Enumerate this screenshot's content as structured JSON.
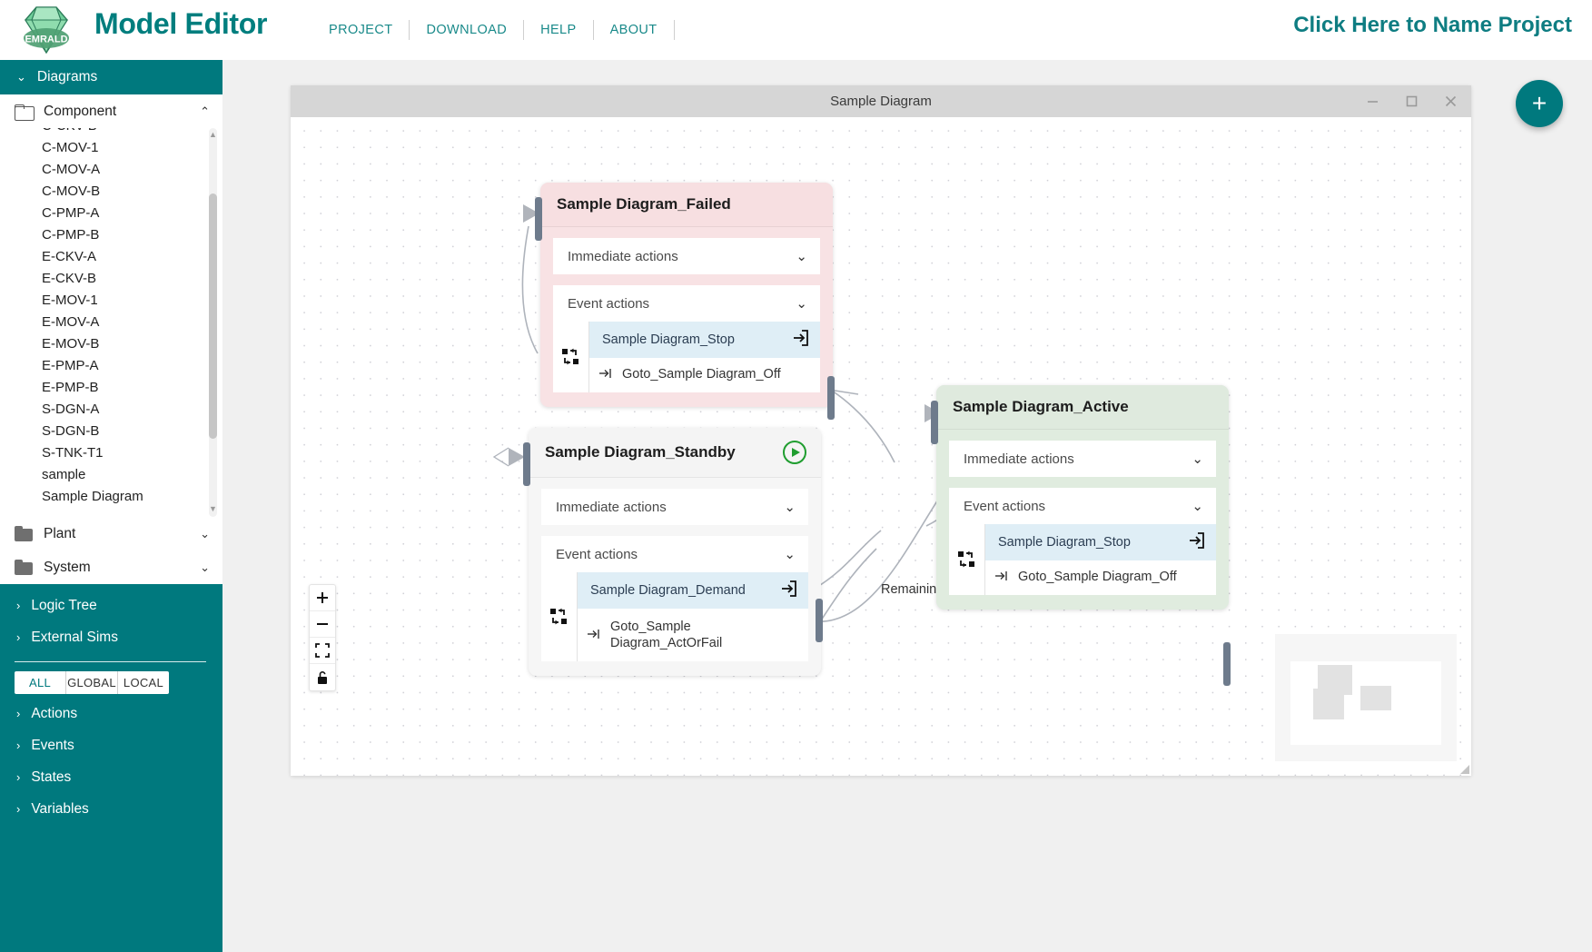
{
  "header": {
    "logo_text": "EMRALD",
    "app_title": "Model Editor",
    "nav": [
      {
        "label": "PROJECT"
      },
      {
        "label": "DOWNLOAD"
      },
      {
        "label": "HELP"
      },
      {
        "label": "ABOUT"
      }
    ],
    "project_name": "Click Here to Name Project",
    "accent_color": "#00797e"
  },
  "sidebar": {
    "section_title": "Diagrams",
    "folders": [
      {
        "label": "Component",
        "expanded": true,
        "caret": "⌃"
      },
      {
        "label": "Plant",
        "expanded": false,
        "caret": "⌄"
      },
      {
        "label": "System",
        "expanded": false,
        "caret": "⌄"
      }
    ],
    "component_items": [
      {
        "label": "C-CKV-B"
      },
      {
        "label": "C-MOV-1"
      },
      {
        "label": "C-MOV-A"
      },
      {
        "label": "C-MOV-B"
      },
      {
        "label": "C-PMP-A"
      },
      {
        "label": "C-PMP-B"
      },
      {
        "label": "E-CKV-A"
      },
      {
        "label": "E-CKV-B"
      },
      {
        "label": "E-MOV-1"
      },
      {
        "label": "E-MOV-A"
      },
      {
        "label": "E-MOV-B"
      },
      {
        "label": "E-PMP-A"
      },
      {
        "label": "E-PMP-B"
      },
      {
        "label": "S-DGN-A"
      },
      {
        "label": "S-DGN-B"
      },
      {
        "label": "S-TNK-T1"
      },
      {
        "label": "sample"
      },
      {
        "label": "Sample Diagram"
      }
    ],
    "sections": [
      {
        "label": "Logic Tree"
      },
      {
        "label": "External Sims"
      }
    ],
    "scope_filter": {
      "options": [
        {
          "label": "ALL",
          "selected": true
        },
        {
          "label": "GLOBAL",
          "selected": false
        },
        {
          "label": "LOCAL",
          "selected": false
        }
      ]
    },
    "lower_sections": [
      {
        "label": "Actions"
      },
      {
        "label": "Events"
      },
      {
        "label": "States"
      },
      {
        "label": "Variables"
      }
    ]
  },
  "window": {
    "title": "Sample Diagram",
    "controls": [
      {
        "name": "minimize",
        "glyph": "—"
      },
      {
        "name": "maximize",
        "glyph": "□"
      },
      {
        "name": "close",
        "glyph": "✕"
      }
    ]
  },
  "canvas": {
    "edge_labels": [
      {
        "text": "Remaining"
      }
    ],
    "zoom_controls": [
      {
        "name": "zoom-in",
        "glyph": "+"
      },
      {
        "name": "zoom-out",
        "glyph": "−"
      },
      {
        "name": "fit-view",
        "glyph": "fit"
      },
      {
        "name": "lock",
        "glyph": "lock"
      }
    ],
    "add_button_label": "+",
    "nodes": [
      {
        "id": "failed",
        "title": "Sample Diagram_Failed",
        "kind": "failed",
        "color": "#f8e2e4",
        "has_play": false,
        "immediate_actions_label": "Immediate actions",
        "event_actions_label": "Event actions",
        "events": [
          {
            "name": "Sample Diagram_Stop",
            "actions": [
              {
                "name": "Goto_Sample Diagram_Off"
              }
            ]
          }
        ]
      },
      {
        "id": "standby",
        "title": "Sample Diagram_Standby",
        "kind": "standby",
        "color": "#f6f6f6",
        "has_play": true,
        "immediate_actions_label": "Immediate actions",
        "event_actions_label": "Event actions",
        "events": [
          {
            "name": "Sample Diagram_Demand",
            "actions": [
              {
                "name": "Goto_Sample Diagram_ActOrFail"
              }
            ]
          }
        ]
      },
      {
        "id": "active",
        "title": "Sample Diagram_Active",
        "kind": "active",
        "color": "#e0ecdf",
        "has_play": false,
        "immediate_actions_label": "Immediate actions",
        "event_actions_label": "Event actions",
        "events": [
          {
            "name": "Sample Diagram_Stop",
            "actions": [
              {
                "name": "Goto_Sample Diagram_Off"
              }
            ]
          }
        ]
      }
    ]
  }
}
